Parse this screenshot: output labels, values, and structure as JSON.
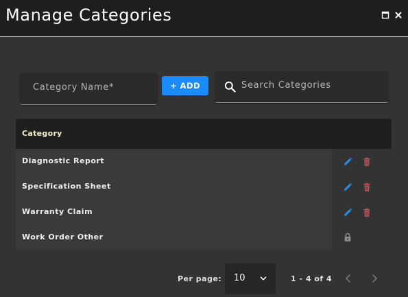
{
  "window": {
    "title": "Manage Categories",
    "maximize_icon": "maximize-icon",
    "close_icon": "close-icon"
  },
  "form": {
    "category_name_placeholder": "Category Name*",
    "category_name_value": "",
    "add_label": "+ ADD",
    "search_placeholder": "Search Categories",
    "search_value": "",
    "search_icon": "search-icon"
  },
  "table": {
    "header": "Category",
    "rows": [
      {
        "name": "Diagnostic Report",
        "actions": [
          "edit",
          "delete"
        ]
      },
      {
        "name": "Specification Sheet",
        "actions": [
          "edit",
          "delete"
        ]
      },
      {
        "name": "Warranty Claim",
        "actions": [
          "edit",
          "delete"
        ]
      },
      {
        "name": "Work Order Other",
        "actions": [
          "locked"
        ]
      }
    ]
  },
  "pagination": {
    "per_page_label": "Per page:",
    "per_page_value": "10",
    "range_text": "1 - 4 of 4"
  },
  "colors": {
    "accent": "#1a8cff",
    "edit_icon": "#2f8fe8",
    "delete_icon": "#c0565a",
    "lock_icon": "#8a8a8a",
    "header_text": "#f2f0c8"
  }
}
